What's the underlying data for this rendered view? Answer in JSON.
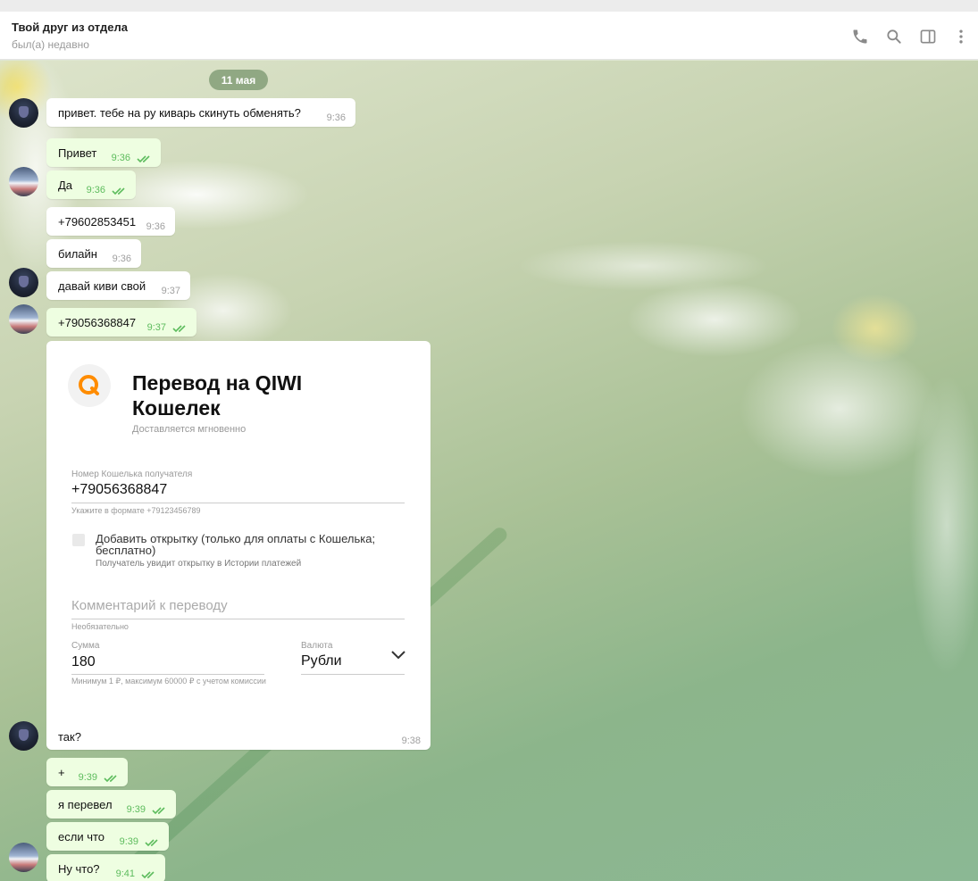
{
  "header": {
    "title": "Твой друг из отдела",
    "status": "был(а) недавно",
    "icons": [
      "phone-icon",
      "search-icon",
      "sidebar-toggle-icon",
      "more-vertical-icon"
    ]
  },
  "chat": {
    "date": "11 мая",
    "messages": [
      {
        "text": "привет. тебе на ру киварь скинуть обменять?",
        "time": "9:36",
        "direction": "in"
      },
      {
        "text": "Привет",
        "time": "9:36",
        "direction": "out",
        "read": true
      },
      {
        "text": "Да",
        "time": "9:36",
        "direction": "out",
        "read": true
      },
      {
        "text": "+79602853451",
        "time": "9:36",
        "direction": "in"
      },
      {
        "text": "билайн",
        "time": "9:36",
        "direction": "in"
      },
      {
        "text": "давай киви свой",
        "time": "9:37",
        "direction": "in"
      },
      {
        "text": "+79056368847",
        "time": "9:37",
        "direction": "out",
        "read": true
      },
      {
        "text": "так?",
        "time": "9:38",
        "direction": "in"
      },
      {
        "text": "+",
        "time": "9:39",
        "direction": "out",
        "read": true
      },
      {
        "text": "я перевел",
        "time": "9:39",
        "direction": "out",
        "read": true
      },
      {
        "text": "если что",
        "time": "9:39",
        "direction": "out",
        "read": true
      },
      {
        "text": "Ну что?",
        "time": "9:41",
        "direction": "out",
        "read": true
      }
    ]
  },
  "qiwi_card": {
    "title": "Перевод на QIWI Кошелек",
    "subtitle": "Доставляется мгновенно",
    "wallet_label": "Номер Кошелька получателя",
    "wallet_value": "+79056368847",
    "wallet_hint": "Укажите в формате +79123456789",
    "postcard_label": "Добавить открытку (только для оплаты с Кошелька; бесплатно)",
    "postcard_hint": "Получатель увидит открытку в Истории платежей",
    "comment_placeholder": "Комментарий к переводу",
    "comment_hint": "Необязательно",
    "amount_label": "Сумма",
    "amount_value": "180",
    "amount_hint": "Минимум 1 ₽, максимум 60000 ₽ с учетом комиссии",
    "currency_label": "Валюта",
    "currency_value": "Рубли"
  },
  "colors": {
    "outgoing_bubble": "#eefee1",
    "incoming_bubble": "#ffffff",
    "read_ticks": "#5dbc5d",
    "qiwi_orange": "#ff8c00",
    "date_pill": "#7f9a74"
  }
}
